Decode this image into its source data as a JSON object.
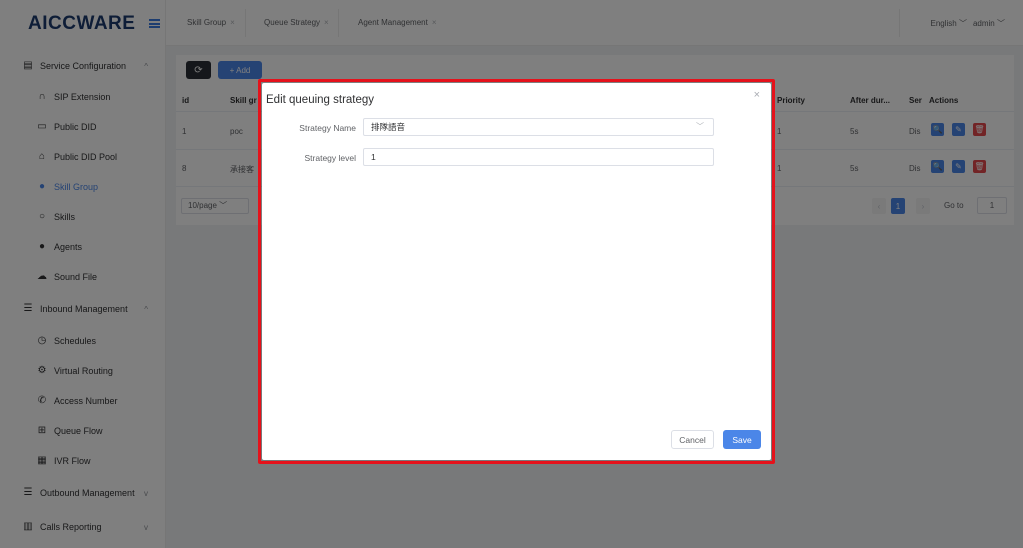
{
  "brand": {
    "logo_prefix": "AICC",
    "logo_suffix": "WARE"
  },
  "sidebar": {
    "groups": [
      {
        "label": "Service Configuration",
        "icon": "id-card-icon"
      },
      {
        "label": "Inbound Management",
        "icon": "list-icon"
      },
      {
        "label": "Outbound Management",
        "icon": "list-icon"
      },
      {
        "label": "Calls Reporting",
        "icon": "bar-chart-icon"
      }
    ],
    "items": [
      {
        "label": "SIP Extension",
        "icon": "headset-icon"
      },
      {
        "label": "Public DID",
        "icon": "folder-icon"
      },
      {
        "label": "Public DID Pool",
        "icon": "home-icon"
      },
      {
        "label": "Skill Group",
        "icon": "user-icon"
      },
      {
        "label": "Skills",
        "icon": "user-outline-icon"
      },
      {
        "label": "Agents",
        "icon": "user-icon"
      },
      {
        "label": "Sound File",
        "icon": "cloud-icon"
      },
      {
        "label": "Schedules",
        "icon": "clock-icon"
      },
      {
        "label": "Virtual Routing",
        "icon": "gear-icon"
      },
      {
        "label": "Access Number",
        "icon": "phone-icon"
      },
      {
        "label": "Queue Flow",
        "icon": "queue-icon"
      },
      {
        "label": "IVR Flow",
        "icon": "grid-icon"
      }
    ]
  },
  "topbar": {
    "tabs": [
      {
        "label": "Skill Group"
      },
      {
        "label": "Queue Strategy"
      },
      {
        "label": "Agent Management"
      }
    ],
    "tab_close": "×",
    "language": "English",
    "user": "admin"
  },
  "table": {
    "add_label": "+ Add",
    "refresh_glyph": "⟳",
    "headers": [
      "id",
      "Skill gr",
      "Priority",
      "After dur...",
      "Ser",
      "Actions"
    ],
    "rows": [
      {
        "id": "1",
        "name": "poc",
        "priority": "1",
        "after": "5s",
        "ser": "Dis"
      },
      {
        "id": "8",
        "name": "承接客",
        "priority": "1",
        "after": "5s",
        "ser": "Dis"
      }
    ],
    "page_size": "10/page",
    "current_page": "1",
    "goto_label": "Go to",
    "goto_value": "1"
  },
  "modal": {
    "title": "Edit queuing strategy",
    "close_glyph": "×",
    "fields": [
      {
        "label": "Strategy Name",
        "value": "排隊語音"
      },
      {
        "label": "Strategy level",
        "value": "1"
      }
    ],
    "cancel_label": "Cancel",
    "save_label": "Save"
  },
  "colors": {
    "primary": "#4b86e8",
    "danger": "#e5484d",
    "highlight": "#e5121b"
  }
}
